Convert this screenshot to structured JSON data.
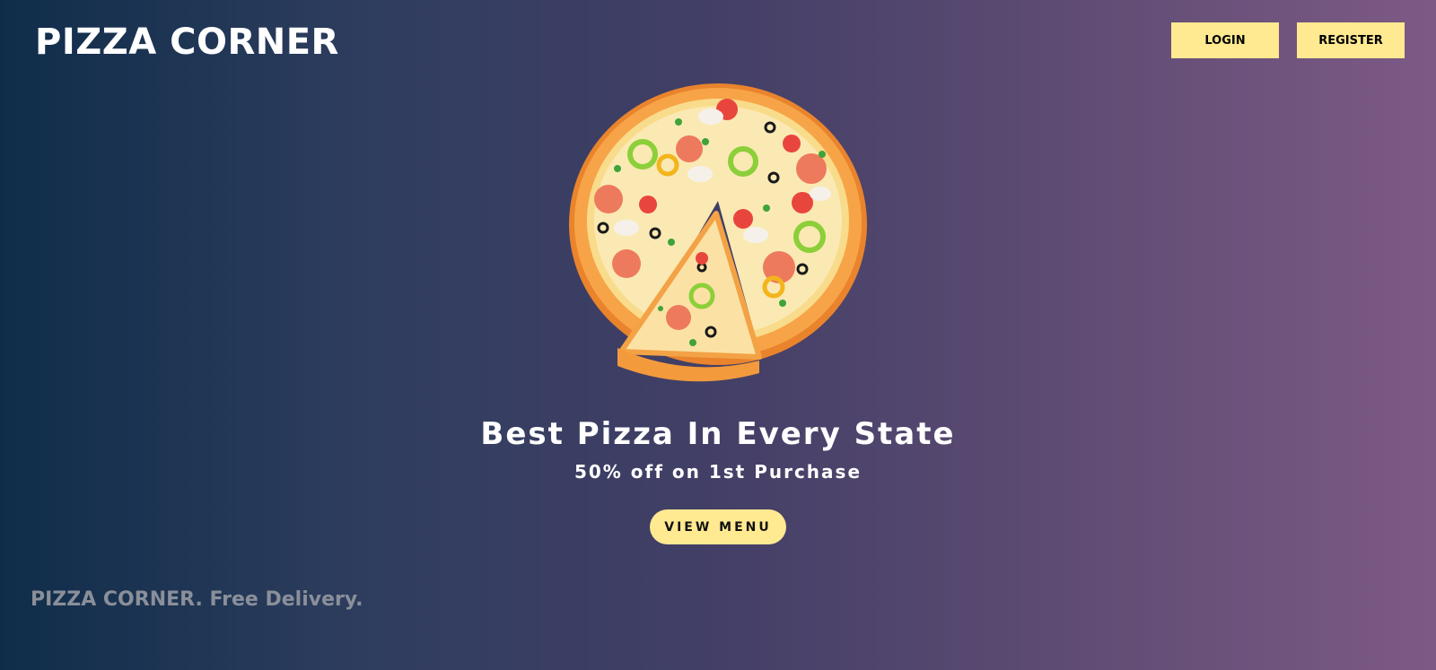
{
  "header": {
    "brand": "PIZZA CORNER",
    "login_label": "LOGIN",
    "register_label": "REGISTER"
  },
  "hero": {
    "image_icon": "pizza-illustration",
    "title": "Best Pizza In Every State",
    "subtitle": "50% off on 1st Purchase",
    "cta_label": "VIEW MENU"
  },
  "footer": {
    "tagline": "PIZZA CORNER. Free Delivery."
  },
  "colors": {
    "accent": "#ffe991",
    "gradient_start": "#0f2d4a",
    "gradient_end": "#7d5a85",
    "footer_text": "#8a8f99"
  }
}
